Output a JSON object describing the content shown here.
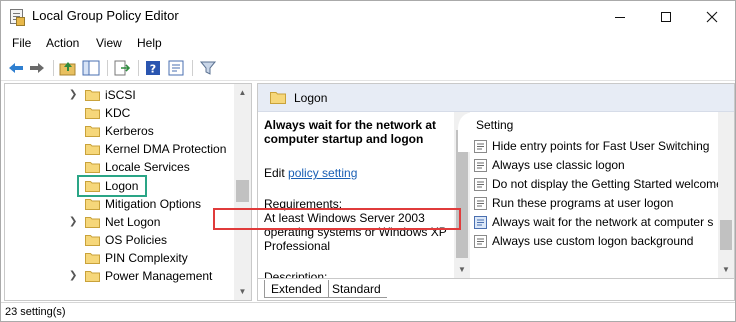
{
  "window": {
    "title": "Local Group Policy Editor"
  },
  "menu": [
    "File",
    "Action",
    "View",
    "Help"
  ],
  "toolbar": {
    "icons": [
      "back-arrow-icon",
      "forward-arrow-icon",
      "up-folder-icon",
      "show-hide-tree-icon",
      "export-list-icon",
      "help-icon",
      "properties-icon",
      "filter-icon"
    ]
  },
  "tree": {
    "items": [
      {
        "label": "iSCSI",
        "expandable": true
      },
      {
        "label": "KDC",
        "expandable": false
      },
      {
        "label": "Kerberos",
        "expandable": false
      },
      {
        "label": "Kernel DMA Protection",
        "expandable": false
      },
      {
        "label": "Locale Services",
        "expandable": false
      },
      {
        "label": "Logon",
        "expandable": false,
        "selected": true
      },
      {
        "label": "Mitigation Options",
        "expandable": false
      },
      {
        "label": "Net Logon",
        "expandable": true
      },
      {
        "label": "OS Policies",
        "expandable": false
      },
      {
        "label": "PIN Complexity",
        "expandable": false
      },
      {
        "label": "Power Management",
        "expandable": true
      }
    ],
    "highlight_color": "#2aa586"
  },
  "details": {
    "folder_title": "Logon",
    "heading": "Always wait for the network at computer startup and logon",
    "edit_prefix": "Edit",
    "edit_link": "policy setting",
    "requirements_label": "Requirements:",
    "requirements_text": "At least Windows Server 2003 operating systems or Windows XP Professional",
    "description_label": "Description:"
  },
  "settings": {
    "column_header": "Setting",
    "items": [
      "Hide entry points for Fast User Switching",
      "Always use classic logon",
      "Do not display the Getting Started welcome",
      "Run these programs at user logon",
      "Always wait for the network at computer s",
      "Always use custom logon background"
    ],
    "highlighted_index": 4,
    "highlight_color": "#e03b3b"
  },
  "tabs": [
    "Extended",
    "Standard"
  ],
  "status": {
    "text": "23 setting(s)"
  }
}
